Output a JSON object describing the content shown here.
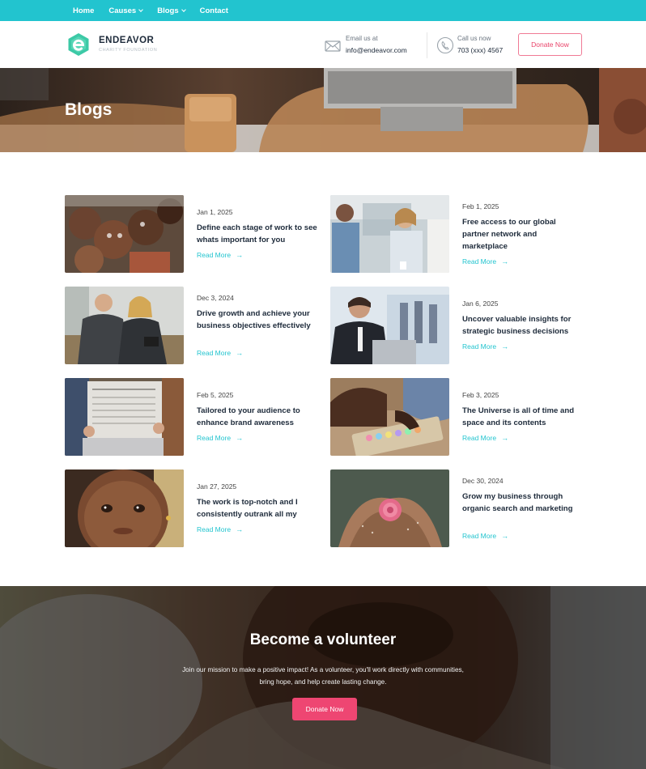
{
  "nav": {
    "items": [
      {
        "label": "Home",
        "dropdown": false
      },
      {
        "label": "Causes",
        "dropdown": true
      },
      {
        "label": "Blogs",
        "dropdown": true
      },
      {
        "label": "Contact",
        "dropdown": false
      }
    ]
  },
  "header": {
    "brand": "ENDEAVOR",
    "brand_sub": "CHARITY FOUNDATION",
    "email_label": "Email us at",
    "email_value": "info@endeavor.com",
    "call_label": "Call us now",
    "call_value": "703 (xxx) 4567",
    "donate_label": "Donate Now"
  },
  "hero": {
    "title": "Blogs"
  },
  "blogs": [
    {
      "date": "Jan 1, 2025",
      "title": "Define each stage of work to see whats important for you",
      "more": "Read More",
      "image": "children-group-photo"
    },
    {
      "date": "Feb 1, 2025",
      "title": "Free access to our global partner network and marketplace",
      "more": "Read More",
      "image": "office-colleagues-photo"
    },
    {
      "date": "Dec 3, 2024",
      "title": "Drive growth and achieve your business objectives effectively",
      "more": "Read More",
      "image": "business-meeting-photo"
    },
    {
      "date": "Jan 6, 2025",
      "title": "Uncover valuable insights for strategic business decisions",
      "more": "Read More",
      "image": "businessman-laptop-photo"
    },
    {
      "date": "Feb 5, 2025",
      "title": "Tailored to your audience to enhance brand awareness",
      "more": "Read More",
      "image": "newspaper-reader-photo"
    },
    {
      "date": "Feb 3, 2025",
      "title": "The Universe is all of time and space and its contents",
      "more": "Read More",
      "image": "child-chalk-photo"
    },
    {
      "date": "Jan 27, 2025",
      "title": "The work is top-notch and I consistently outrank all my",
      "more": "Read More",
      "image": "child-portrait-photo"
    },
    {
      "date": "Dec 30, 2024",
      "title": "Grow my business through organic search and marketing",
      "more": "Read More",
      "image": "hands-flower-photo"
    }
  ],
  "volunteer": {
    "title": "Become a volunteer",
    "text": "Join our mission to make a positive impact! As a volunteer, you'll work directly with communities, bring hope, and help create lasting change.",
    "button": "Donate Now"
  },
  "colors": {
    "accent": "#22c4cf",
    "donate": "#ee4672",
    "heading": "#1d2a3a"
  }
}
